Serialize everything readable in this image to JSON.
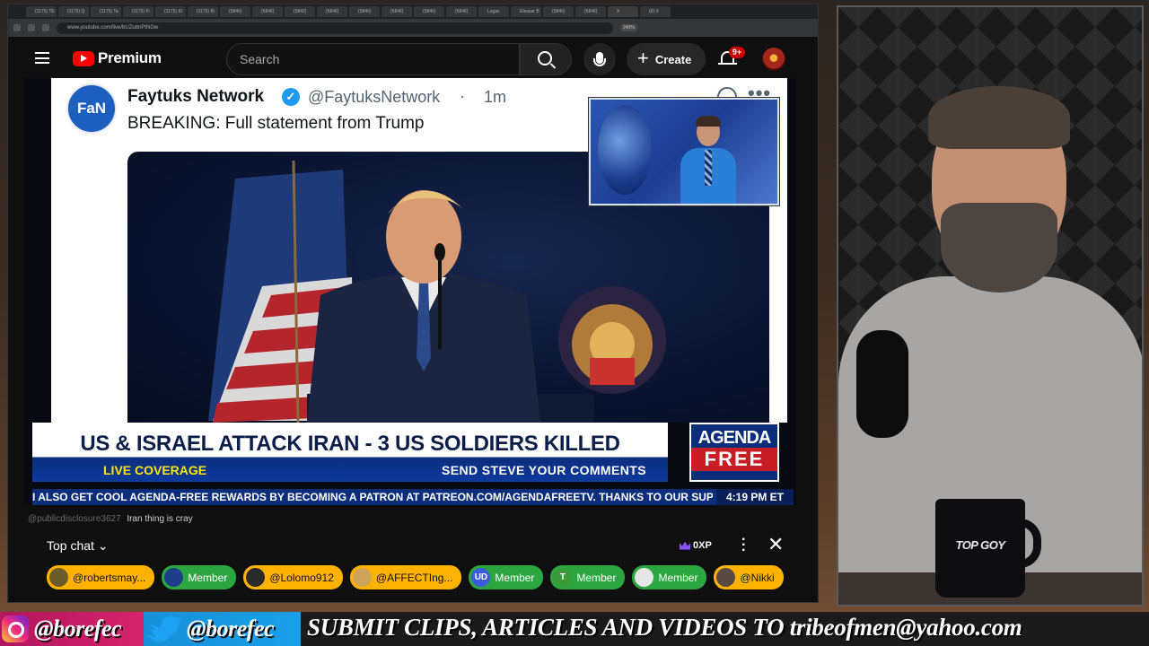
{
  "browser": {
    "tabs": [
      "(1175) TE",
      "(1175) Q",
      "(1175) Ta",
      "(1175) Fi",
      "(1175) El",
      "(1175) Br",
      "(5846)",
      "(5846)",
      "(5842)",
      "(5846)",
      "(5846)",
      "(5846)",
      "(5846)",
      "(5846)",
      "Legac",
      "Eleazar B",
      "(5846)",
      "(5846)",
      "X",
      "(8) X"
    ],
    "url": "www.youtube.com/live/bUZuttnPtNGw",
    "zoom": "240%"
  },
  "youtube": {
    "logo_text": "Premium",
    "search_placeholder": "Search",
    "create_label": "Create",
    "notifications_badge": "9+"
  },
  "tweet": {
    "avatar_text": "FaN",
    "name": "Faytuks Network",
    "handle": "@FaytuksNetwork",
    "separator": "·",
    "time": "1m",
    "text": "BREAKING: Full statement from Trump",
    "more": "•••"
  },
  "broadcast": {
    "headline": "US & ISRAEL ATTACK IRAN - 3 US SOLDIERS KILLED",
    "live_label": "LIVE COVERAGE",
    "send_label": "SEND STEVE YOUR COMMENTS",
    "logo_top": "AGENDA",
    "logo_bottom": "FREE",
    "ticker": "I ALSO GET COOL AGENDA-FREE REWARDS BY BECOMING A PATRON AT PATREON.COM/AGENDAFREETV. THANKS TO OUR SUPER",
    "time": "4:19 PM ET"
  },
  "chat": {
    "preview_author": "@publicdisclosure3627",
    "preview_message": "Iran thing is cray",
    "mode_label": "Top chat",
    "xp_label": "0XP",
    "chips": [
      {
        "label": "@robertsmay...",
        "icon": "",
        "style": "gold",
        "icon_color": "#6b5a2a"
      },
      {
        "label": "Member",
        "icon": "",
        "style": "green",
        "icon_color": "#1d3f8a"
      },
      {
        "label": "@Lolomo912",
        "icon": "",
        "style": "gold",
        "icon_color": "#2a2a2a"
      },
      {
        "label": "@AFFECTIng...",
        "icon": "",
        "style": "gold",
        "icon_color": "#cfa35a"
      },
      {
        "label": "Member",
        "icon": "UD",
        "style": "green",
        "icon_color": "#3b5bdb"
      },
      {
        "label": "Member",
        "icon": "T",
        "style": "green",
        "icon_color": "#3a9a3a"
      },
      {
        "label": "Member",
        "icon": "",
        "style": "green",
        "icon_color": "#e6e6e6"
      },
      {
        "label": "@Nikki",
        "icon": "",
        "style": "gold",
        "icon_color": "#5a4a44"
      }
    ]
  },
  "webcam": {
    "mug_text": "TOP GOY"
  },
  "banner": {
    "instagram_handle": "@borefec",
    "twitter_handle": "@borefec",
    "submit_text": "SUBMIT CLIPS, ARTICLES AND VIDEOS TO tribeofmen@yahoo.com"
  }
}
